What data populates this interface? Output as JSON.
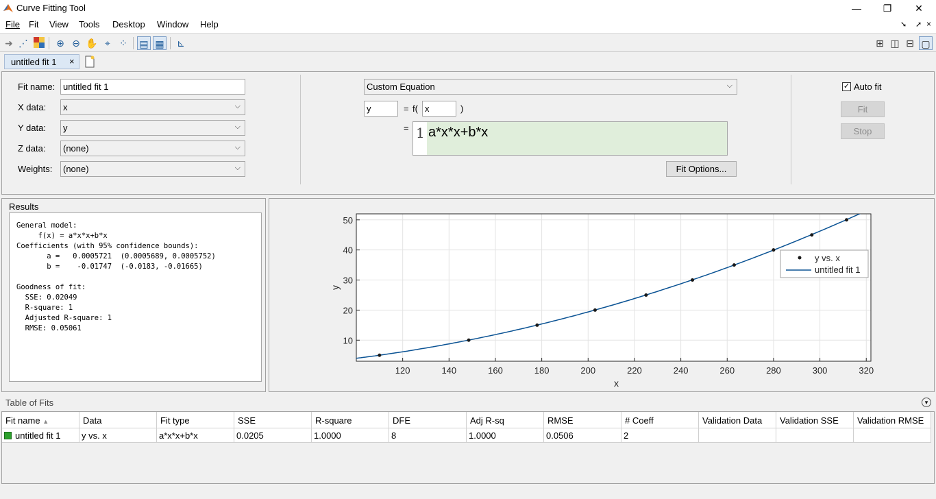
{
  "window": {
    "title": "Curve Fitting Tool"
  },
  "menu": [
    "File",
    "Fit",
    "View",
    "Tools",
    "Desktop",
    "Window",
    "Help"
  ],
  "tab": {
    "label": "untitled fit 1",
    "close": "×"
  },
  "fit_name": {
    "label": "Fit name:",
    "value": "untitled fit 1"
  },
  "x_data": {
    "label": "X data:",
    "value": "x"
  },
  "y_data": {
    "label": "Y data:",
    "value": "y"
  },
  "z_data": {
    "label": "Z data:",
    "value": "(none)"
  },
  "weights": {
    "label": "Weights:",
    "value": "(none)"
  },
  "fit_type": {
    "value": "Custom Equation"
  },
  "equation": {
    "lhs": "y",
    "eq": "=",
    "f_open": "f(",
    "var": "x",
    "f_close": ")",
    "eq2": "=",
    "line_no": "1",
    "expr": "a*x*x+b*x"
  },
  "fit_options_button": "Fit Options...",
  "auto_fit": {
    "label": "Auto fit",
    "checked": true
  },
  "fit_button": "Fit",
  "stop_button": "Stop",
  "results": {
    "title": "Results",
    "text": "General model:\n     f(x) = a*x*x+b*x\nCoefficients (with 95% confidence bounds):\n       a =   0.0005721  (0.0005689, 0.0005752)\n       b =    -0.01747  (-0.0183, -0.01665)\n\nGoodness of fit:\n  SSE: 0.02049\n  R-square: 1\n  Adjusted R-square: 1\n  RMSE: 0.05061"
  },
  "chart_data": {
    "type": "scatter",
    "xlabel": "x",
    "ylabel": "y",
    "xlim": [
      100,
      322
    ],
    "ylim": [
      3,
      52
    ],
    "xticks": [
      120,
      140,
      160,
      180,
      200,
      220,
      240,
      260,
      280,
      300,
      320
    ],
    "yticks": [
      10,
      20,
      30,
      40,
      50
    ],
    "grid": true,
    "legend_position": "top-right",
    "series": [
      {
        "name": "y vs. x",
        "kind": "points",
        "x": [
          110,
          148.5,
          178,
          203,
          225,
          245,
          263,
          280,
          296.5,
          311.5
        ],
        "y": [
          5,
          10,
          15,
          20,
          25,
          30,
          35,
          40,
          45,
          50
        ]
      },
      {
        "name": "untitled fit 1",
        "kind": "curve",
        "a": 0.0005721,
        "b": -0.01747
      }
    ],
    "colors": {
      "series": "#0b5394"
    }
  },
  "table": {
    "title": "Table of Fits",
    "columns": [
      "Fit name",
      "Data",
      "Fit type",
      "SSE",
      "R-square",
      "DFE",
      "Adj R-sq",
      "RMSE",
      "# Coeff",
      "Validation Data",
      "Validation SSE",
      "Validation RMSE"
    ],
    "sort_indicator": "▲",
    "rows": [
      [
        "untitled fit 1",
        "y vs. x",
        "a*x*x+b*x",
        "0.0205",
        "1.0000",
        "8",
        "1.0000",
        "0.0506",
        "2",
        "",
        "",
        ""
      ]
    ],
    "row_color": "#2ca02c"
  }
}
